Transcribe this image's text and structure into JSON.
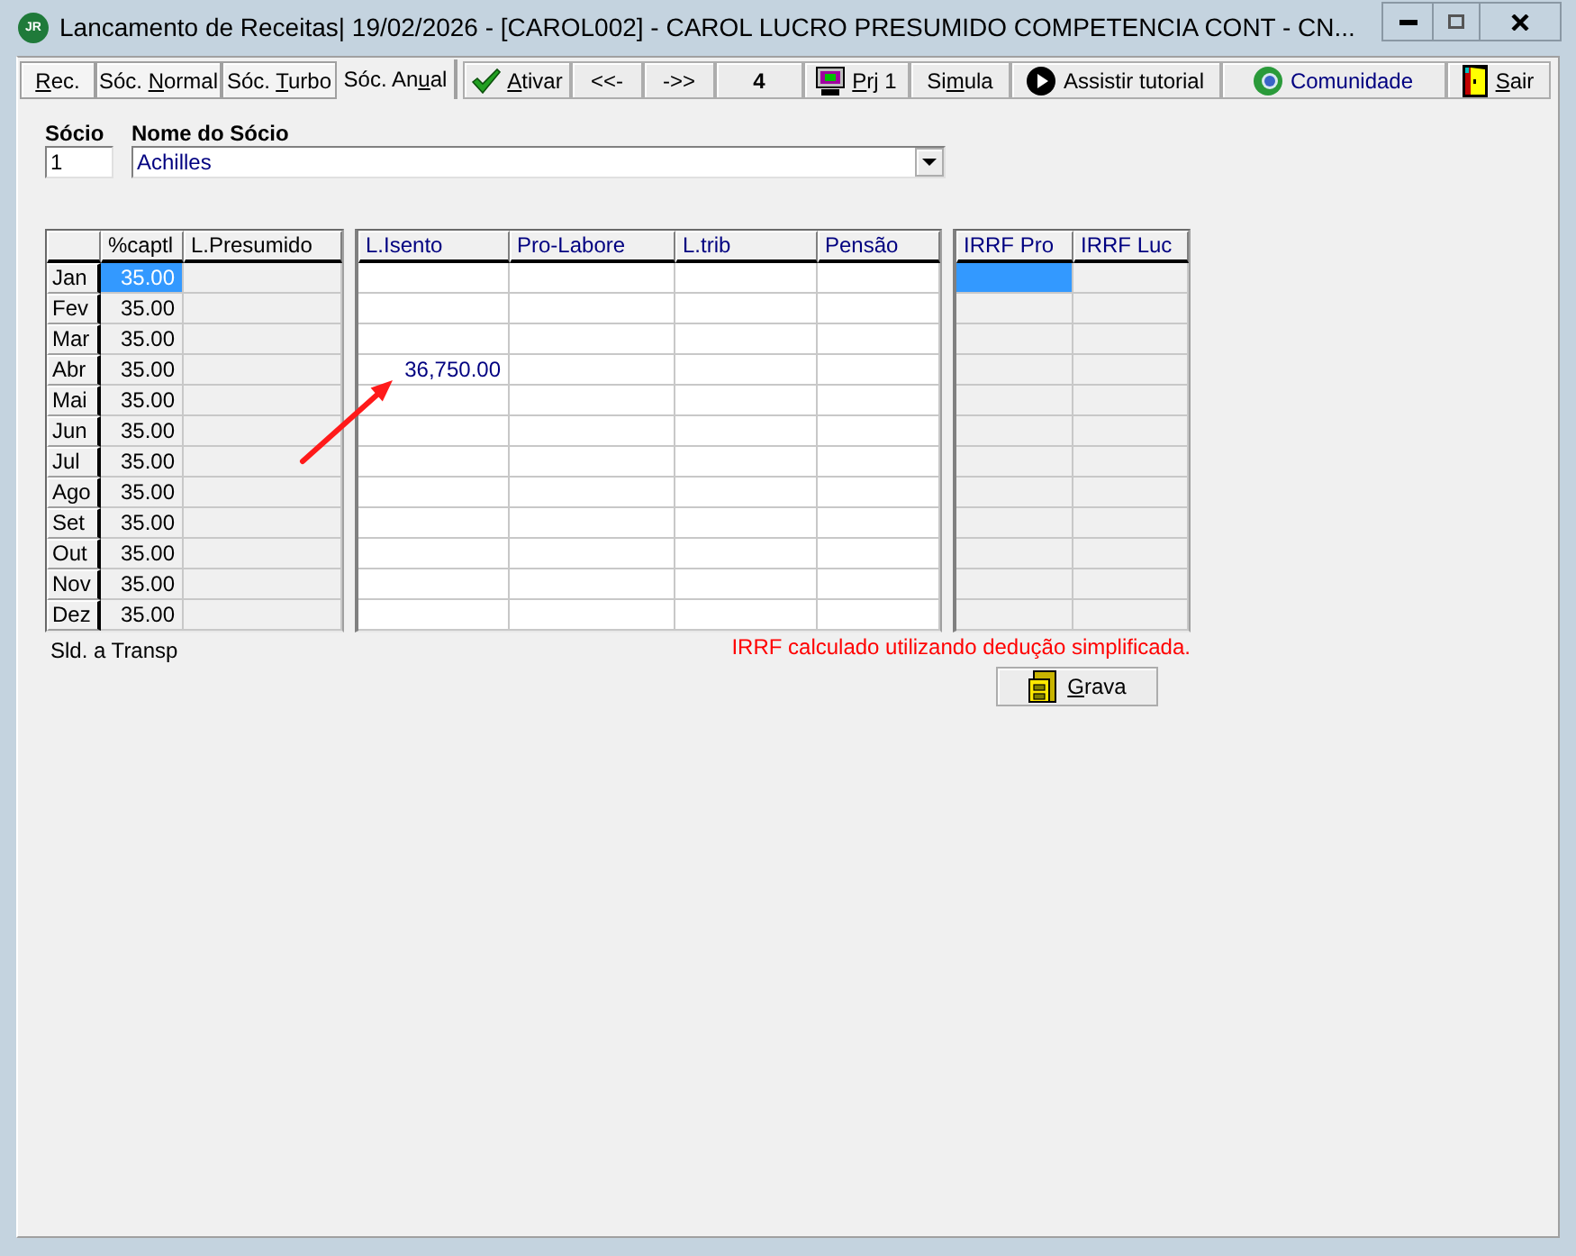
{
  "window": {
    "logo": "JR",
    "title": "Lancamento de Receitas| 19/02/2026 - [CAROL002] - CAROL LUCRO PRESUMIDO COMPETENCIA CONT - CN..."
  },
  "tabs": [
    {
      "label": {
        "key": "R",
        "post": "ec."
      },
      "selected": false
    },
    {
      "label": {
        "pre": "Sóc. ",
        "key": "N",
        "post": "ormal"
      },
      "selected": false
    },
    {
      "label": {
        "pre": "Sóc. ",
        "key": "T",
        "post": "urbo"
      },
      "selected": false
    },
    {
      "label": {
        "pre": "Sóc. An",
        "key": "u",
        "post": "al"
      },
      "selected": true
    }
  ],
  "toolbar": [
    {
      "label": {
        "key": "A",
        "post": "tivar"
      }
    },
    {
      "label": {
        "pre": "<<-"
      }
    },
    {
      "label": {
        "pre": "->>"
      }
    },
    {
      "label": {
        "pre": "4"
      }
    },
    {
      "label": {
        "key": "P",
        "post": "rj 1"
      }
    },
    {
      "label": {
        "pre": "Si",
        "key": "m",
        "post": "ula"
      }
    },
    {
      "label": {
        "pre": "Assistir tutorial"
      }
    },
    {
      "label": {
        "pre": "Comunidade"
      }
    },
    {
      "label": {
        "key": "S",
        "post": "air"
      }
    }
  ],
  "partner": {
    "number_label": "Sócio",
    "number": "1",
    "name_label": "Nome do Sócio",
    "name": "Achilles"
  },
  "share_grid": {
    "columns": [
      "%captl",
      "L.Presumido"
    ]
  },
  "income_grid": {
    "columns": [
      "L.Isento",
      "Pro-Labore",
      "L.trib",
      "Pensão"
    ]
  },
  "irrf_grid": {
    "columns": [
      "IRRF Pro",
      "IRRF Luc"
    ]
  },
  "months": [
    {
      "month": "Jan",
      "captl": "35.00",
      "captl_selected": true,
      "irrf_pro_selected": true
    },
    {
      "month": "Fev",
      "captl": "35.00",
      "captl_selected": false,
      "irrf_pro_selected": false
    },
    {
      "month": "Mar",
      "captl": "35.00",
      "captl_selected": false,
      "irrf_pro_selected": false
    },
    {
      "month": "Abr",
      "captl": "35.00",
      "l_isento": "36,750.00",
      "captl_selected": false,
      "irrf_pro_selected": false
    },
    {
      "month": "Mai",
      "captl": "35.00",
      "captl_selected": false,
      "irrf_pro_selected": false
    },
    {
      "month": "Jun",
      "captl": "35.00",
      "captl_selected": false,
      "irrf_pro_selected": false
    },
    {
      "month": "Jul",
      "captl": "35.00",
      "captl_selected": false,
      "irrf_pro_selected": false
    },
    {
      "month": "Ago",
      "captl": "35.00",
      "captl_selected": false,
      "irrf_pro_selected": false
    },
    {
      "month": "Set",
      "captl": "35.00",
      "captl_selected": false,
      "irrf_pro_selected": false
    },
    {
      "month": "Out",
      "captl": "35.00",
      "captl_selected": false,
      "irrf_pro_selected": false
    },
    {
      "month": "Nov",
      "captl": "35.00",
      "captl_selected": false,
      "irrf_pro_selected": false
    },
    {
      "month": "Dez",
      "captl": "35.00",
      "captl_selected": false,
      "irrf_pro_selected": false
    }
  ],
  "balance_label": "Sld. a Transp",
  "note": "IRRF calculado utilizando dedução simplificada.",
  "save_button": {
    "label": {
      "key": "G",
      "post": "rava"
    }
  }
}
